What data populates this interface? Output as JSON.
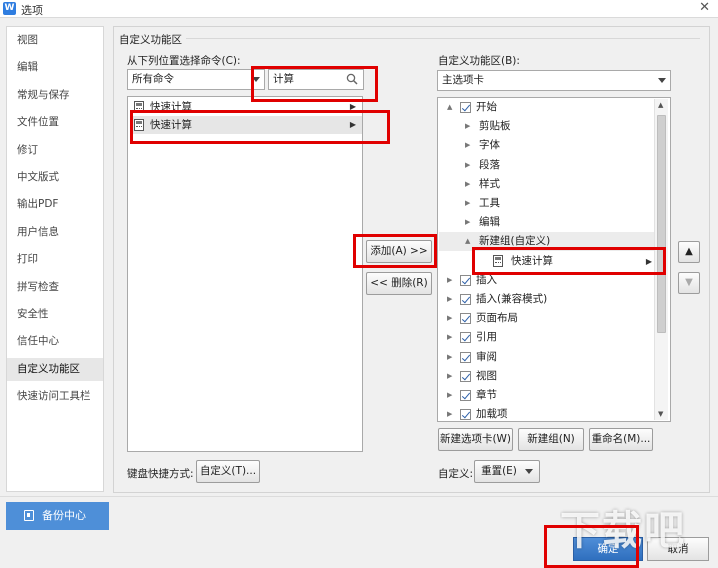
{
  "window": {
    "title": "选项",
    "logo_text": "W"
  },
  "sidebar": {
    "items": [
      {
        "label": "视图"
      },
      {
        "label": "编辑"
      },
      {
        "label": "常规与保存"
      },
      {
        "label": "文件位置"
      },
      {
        "label": "修订"
      },
      {
        "label": "中文版式"
      },
      {
        "label": "输出PDF"
      },
      {
        "label": "用户信息"
      },
      {
        "label": "打印"
      },
      {
        "label": "拼写检查"
      },
      {
        "label": "安全性"
      },
      {
        "label": "信任中心"
      },
      {
        "label": "自定义功能区"
      },
      {
        "label": "快速访问工具栏"
      }
    ],
    "active_index": 12
  },
  "backup": {
    "label": "备份中心",
    "icon": "backup-icon"
  },
  "panel": {
    "group_title": "自定义功能区",
    "commands": {
      "label": "从下列位置选择命令(C):",
      "source_selected": "所有命令",
      "search_value": "计算",
      "items": [
        {
          "label": "快速计算",
          "selected": false
        },
        {
          "label": "快速计算",
          "selected": true
        }
      ]
    },
    "ribbon": {
      "label": "自定义功能区(B):",
      "selected": "主选项卡",
      "tree": [
        {
          "label": "开始",
          "level": 0,
          "expander": "▲",
          "checked": true
        },
        {
          "label": "剪贴板",
          "level": 1,
          "expander": "▶"
        },
        {
          "label": "字体",
          "level": 1,
          "expander": "▶"
        },
        {
          "label": "段落",
          "level": 1,
          "expander": "▶"
        },
        {
          "label": "样式",
          "level": 1,
          "expander": "▶"
        },
        {
          "label": "工具",
          "level": 1,
          "expander": "▶"
        },
        {
          "label": "编辑",
          "level": 1,
          "expander": "▶"
        },
        {
          "label": "新建组(自定义)",
          "level": 1,
          "expander": "▲"
        },
        {
          "label": "快速计算",
          "level": 2
        },
        {
          "label": "插入",
          "level": 0,
          "expander": "▶",
          "checked": true
        },
        {
          "label": "插入(兼容模式)",
          "level": 0,
          "expander": "▶",
          "checked": true
        },
        {
          "label": "页面布局",
          "level": 0,
          "expander": "▶",
          "checked": true
        },
        {
          "label": "引用",
          "level": 0,
          "expander": "▶",
          "checked": true
        },
        {
          "label": "审阅",
          "level": 0,
          "expander": "▶",
          "checked": true
        },
        {
          "label": "视图",
          "level": 0,
          "expander": "▶",
          "checked": true
        },
        {
          "label": "章节",
          "level": 0,
          "expander": "▶",
          "checked": true
        },
        {
          "label": "加载项",
          "level": 0,
          "expander": "▶",
          "checked": true
        }
      ]
    },
    "buttons": {
      "add": "添加(A) >>",
      "remove": "<< 删除(R)",
      "new_tab": "新建选项卡(W)",
      "new_group": "新建组(N)",
      "rename": "重命名(M)...",
      "customize_kb": "自定义(T)...",
      "reset": "重置(E)",
      "move_up": "▲",
      "move_down": "▼"
    },
    "keyboard_label": "键盘快捷方式:",
    "customize_label": "自定义:"
  },
  "footer": {
    "ok": "确定",
    "cancel": "取消",
    "watermark": "下载吧"
  },
  "colors": {
    "accent": "#4e8fd8",
    "highlight_mark": "#e00000"
  }
}
